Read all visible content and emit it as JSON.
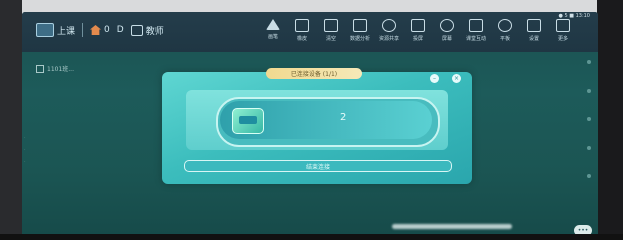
{
  "toolbar": {
    "logo_label": "上课",
    "home_label": "0",
    "device_label": "D",
    "user_label": "教师",
    "tools": [
      {
        "icon": "pen-icon",
        "label": "画笔"
      },
      {
        "icon": "eraser-icon",
        "label": "橡皮"
      },
      {
        "icon": "trash-icon",
        "label": "清空"
      },
      {
        "icon": "chart-icon",
        "label": "数据分析"
      },
      {
        "icon": "cloud-icon",
        "label": "资源共享"
      },
      {
        "icon": "screen-icon",
        "label": "投屏"
      },
      {
        "icon": "eye-icon",
        "label": "屏幕"
      },
      {
        "icon": "grid-icon",
        "label": "课堂互动"
      },
      {
        "icon": "refresh-icon",
        "label": "平板"
      },
      {
        "icon": "settings-icon",
        "label": "设置"
      },
      {
        "icon": "share-icon",
        "label": "更多"
      }
    ],
    "status_text": "● 5 ■ 13:10"
  },
  "side_label": "1101班...",
  "modal": {
    "title": "已连接设备 (1/1)",
    "device_count": "2",
    "action_label": "结束连接",
    "close_glyph": "×"
  },
  "chat_label": "•••"
}
